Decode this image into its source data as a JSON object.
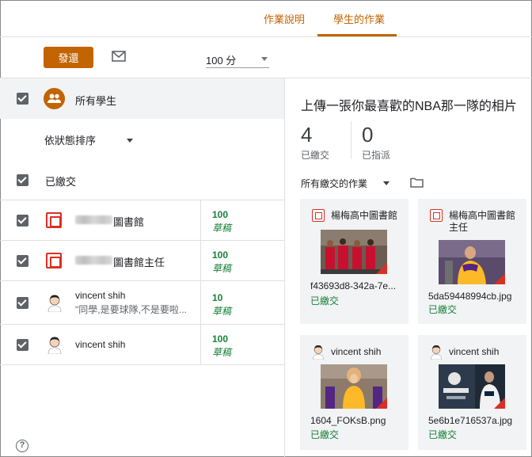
{
  "tabs": {
    "instructions": "作業說明",
    "student_work": "學生的作業"
  },
  "toolbar": {
    "return_label": "發還",
    "points": "100 分"
  },
  "students_panel": {
    "all_students": "所有學生",
    "sort_label": "依狀態排序",
    "submitted_section": "已繳交",
    "rows": [
      {
        "name": "圖書館",
        "grade": "100",
        "status": "草稿",
        "avatar": "photo-box-icon"
      },
      {
        "name": "圖書館主任",
        "grade": "100",
        "status": "草稿",
        "avatar": "photo-box-icon"
      },
      {
        "name": "vincent shih",
        "comment": "\"同學,是要球隊,不是要啦...",
        "grade": "10",
        "status": "草稿",
        "avatar": "person-avatar"
      },
      {
        "name": "vincent shih",
        "grade": "100",
        "status": "草稿",
        "avatar": "person-avatar"
      }
    ]
  },
  "assignment": {
    "title": "上傳一張你最喜歡的NBA那一隊的相片",
    "handed_in_count": "4",
    "handed_in_label": "已繳交",
    "assigned_count": "0",
    "assigned_label": "已指派",
    "filter_label": "所有繳交的作業",
    "cards": [
      {
        "student": "楊梅高中圖書館",
        "file": "f43693d8-342a-7e...",
        "status": "已繳交"
      },
      {
        "student": "楊梅高中圖書館主任",
        "file": "5da59448994cb.jpg",
        "status": "已繳交"
      },
      {
        "student": "vincent shih",
        "file": "1604_FOKsB.png",
        "status": "已繳交"
      },
      {
        "student": "vincent shih",
        "file": "5e6b1e716537a.jpg",
        "status": "已繳交"
      }
    ]
  },
  "colors": {
    "accent": "#c26401",
    "success": "#188038",
    "icon_red": "#d93025"
  }
}
